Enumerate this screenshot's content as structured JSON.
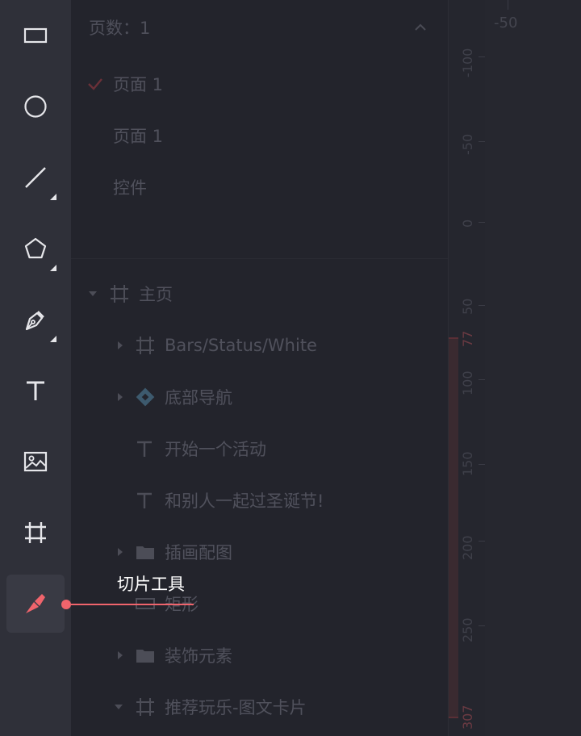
{
  "toolbar": {
    "tools": [
      {
        "name": "rectangle-icon"
      },
      {
        "name": "ellipse-icon"
      },
      {
        "name": "line-icon"
      },
      {
        "name": "polygon-icon"
      },
      {
        "name": "pen-icon"
      },
      {
        "name": "text-icon"
      },
      {
        "name": "image-icon"
      },
      {
        "name": "artboard-icon"
      },
      {
        "name": "slice-icon",
        "active": true
      }
    ]
  },
  "tooltip": {
    "label": "切片工具"
  },
  "pages": {
    "header": "页数：1",
    "items": [
      "页面 1",
      "页面 1",
      "控件"
    ]
  },
  "layers": {
    "root": "主页",
    "items": [
      {
        "label": "Bars/Status/White",
        "icon": "artboard-icon"
      },
      {
        "label": "底部导航",
        "icon": "component-icon"
      },
      {
        "label": "开始一个活动",
        "icon": "text-icon"
      },
      {
        "label": "和别人一起过圣诞节!",
        "icon": "text-icon"
      },
      {
        "label": "插画配图",
        "icon": "folder-icon"
      },
      {
        "label": "矩形",
        "icon": "rectangle-icon"
      },
      {
        "label": "装饰元素",
        "icon": "folder-icon"
      },
      {
        "label": "推荐玩乐-图文卡片",
        "icon": "artboard-icon"
      }
    ]
  },
  "ruler": {
    "horizontal_label": "-50",
    "vertical_labels": [
      "-100",
      "-50",
      "0",
      "50",
      "77",
      "100",
      "150",
      "200",
      "250",
      "307"
    ]
  },
  "colors": {
    "accent": "#f0646c",
    "icon": "#e6e6ea",
    "muted_text": "#50515c",
    "component": "#3d5a6e"
  }
}
